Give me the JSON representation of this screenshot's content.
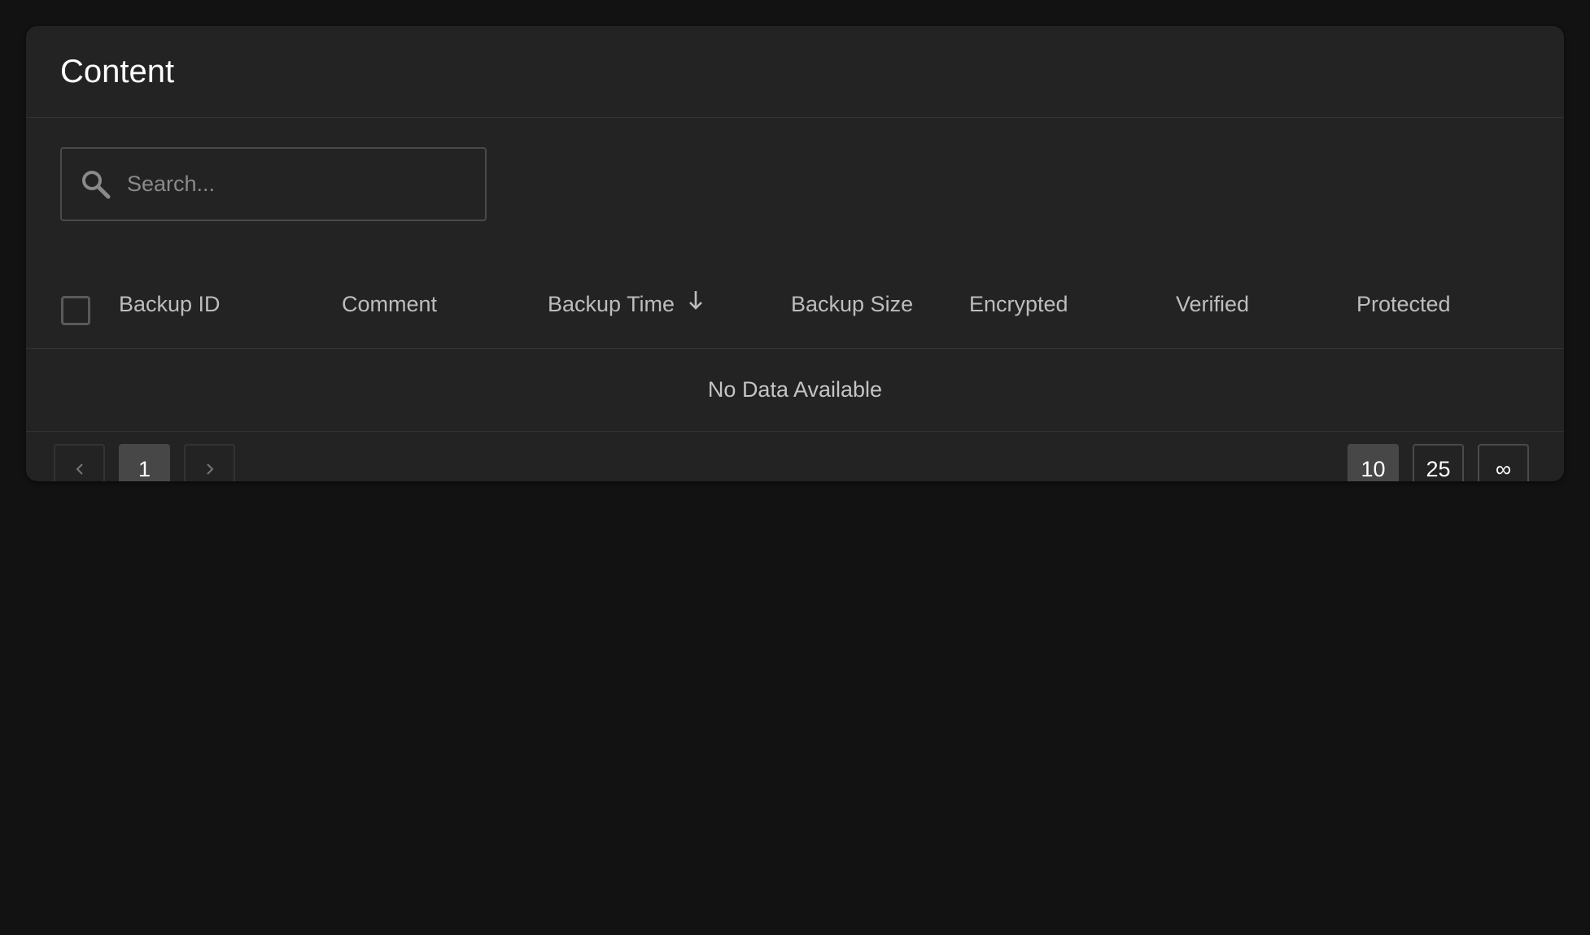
{
  "card": {
    "title": "Content"
  },
  "search": {
    "placeholder": "Search...",
    "value": ""
  },
  "table": {
    "columns": [
      {
        "label": "Backup ID"
      },
      {
        "label": "Comment"
      },
      {
        "label": "Backup Time",
        "sorted": "descending"
      },
      {
        "label": "Backup Size"
      },
      {
        "label": "Encrypted"
      },
      {
        "label": "Verified"
      },
      {
        "label": "Protected"
      }
    ],
    "empty_text": "No Data Available",
    "select_all_checked": false
  },
  "pagination": {
    "prev_icon": "chevron-left-icon",
    "next_icon": "chevron-right-icon",
    "pages": [
      "1"
    ],
    "current_page": "1",
    "page_sizes": [
      "10",
      "25",
      "∞"
    ],
    "selected_page_size": "10"
  },
  "colors": {
    "background": "#121212",
    "card": "#232323",
    "active_button": "#474747"
  }
}
